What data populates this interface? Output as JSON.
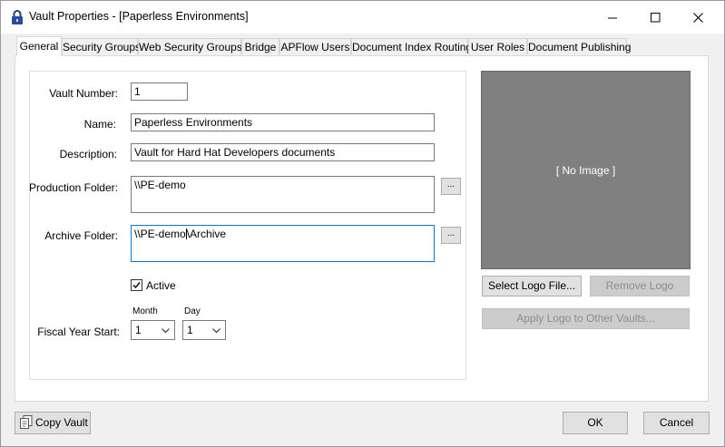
{
  "window": {
    "title": "Vault Properties - [Paperless Environments]"
  },
  "tabs": [
    {
      "label": "General"
    },
    {
      "label": "Security Groups"
    },
    {
      "label": "Web Security Groups"
    },
    {
      "label": "Bridge"
    },
    {
      "label": "APFlow Users"
    },
    {
      "label": "Document Index Routing"
    },
    {
      "label": "User Roles"
    },
    {
      "label": "Document Publishing"
    }
  ],
  "general": {
    "vault_number": {
      "label": "Vault Number:",
      "value": "1"
    },
    "name": {
      "label": "Name:",
      "value": "Paperless Environments"
    },
    "description": {
      "label": "Description:",
      "value": "Vault for Hard Hat Developers documents"
    },
    "production_folder": {
      "label": "Production Folder:",
      "value": "\\\\PE-demo"
    },
    "archive_folder": {
      "label": "Archive Folder:",
      "value_before_caret": "\\\\PE-demo",
      "value_after_caret": "\\Archive"
    },
    "browse_label": "...",
    "active": {
      "label": "Active",
      "checked": true
    },
    "fiscal_year_start": {
      "label": "Fiscal Year Start:",
      "month_label": "Month",
      "day_label": "Day",
      "month_value": "1",
      "day_value": "1"
    }
  },
  "logo": {
    "placeholder": "[ No Image ]",
    "select_button": "Select Logo File...",
    "remove_button": "Remove Logo",
    "apply_button": "Apply Logo to Other Vaults..."
  },
  "footer": {
    "copy_vault": "Copy Vault",
    "ok": "OK",
    "cancel": "Cancel"
  }
}
